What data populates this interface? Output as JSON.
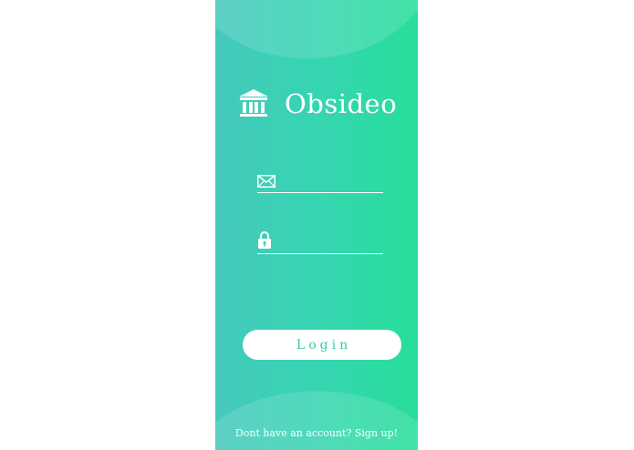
{
  "app": {
    "name": "Obsideo",
    "logo_icon": "bank-building-icon"
  },
  "form": {
    "email": {
      "icon": "envelope-icon",
      "value": "",
      "placeholder": ""
    },
    "password": {
      "icon": "lock-icon",
      "value": "",
      "placeholder": ""
    },
    "login_label": "Login"
  },
  "footer": {
    "signup_text": "Dont have an account? Sign up!"
  },
  "colors": {
    "gradient_start": "#45c9bc",
    "gradient_end": "#27de98",
    "accent_text": "#33cfb0",
    "foreground": "#ffffff"
  }
}
